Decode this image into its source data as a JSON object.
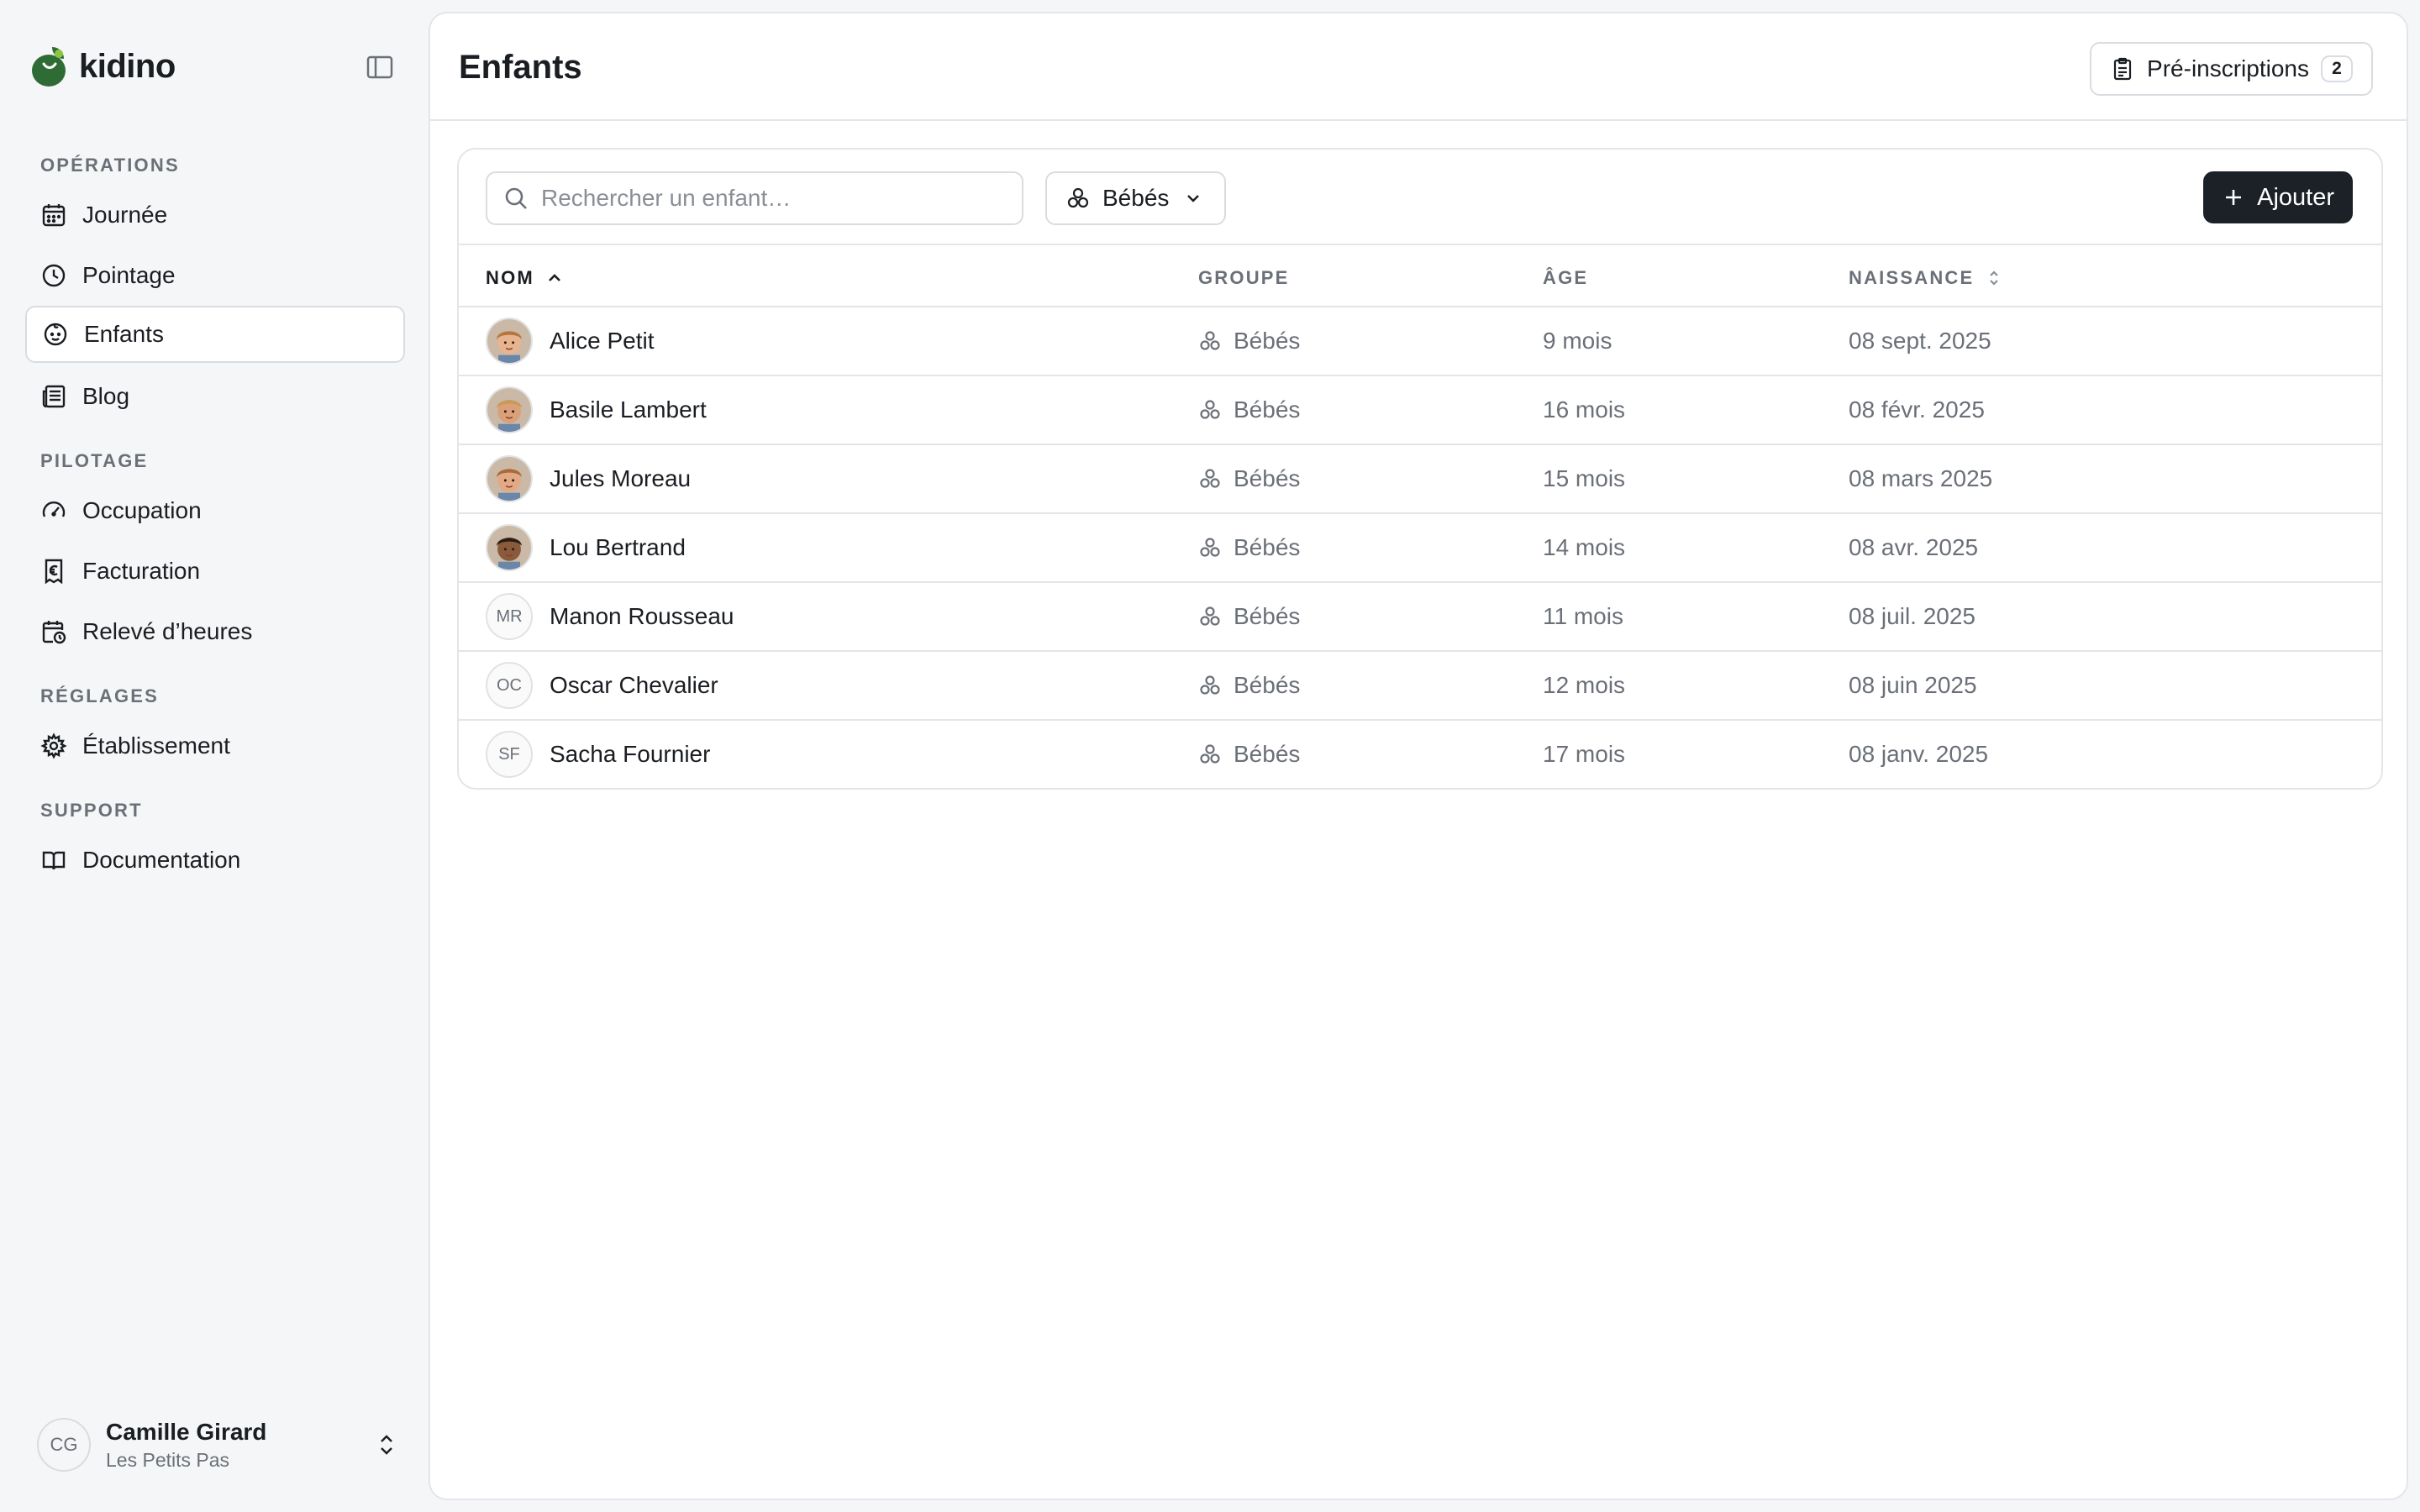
{
  "app": {
    "name": "kidino",
    "brand_color": "#2f6b35"
  },
  "sidebar": {
    "sections": [
      {
        "label": "OPÉRATIONS",
        "items": [
          {
            "label": "Journée",
            "icon": "calendar-icon"
          },
          {
            "label": "Pointage",
            "icon": "clock-icon"
          },
          {
            "label": "Enfants",
            "icon": "child-face-icon",
            "active": true
          },
          {
            "label": "Blog",
            "icon": "newspaper-icon"
          }
        ]
      },
      {
        "label": "PILOTAGE",
        "items": [
          {
            "label": "Occupation",
            "icon": "gauge-icon"
          },
          {
            "label": "Facturation",
            "icon": "invoice-euro-icon"
          },
          {
            "label": "Relevé d’heures",
            "icon": "calendar-clock-icon"
          }
        ]
      },
      {
        "label": "RÉGLAGES",
        "items": [
          {
            "label": "Établissement",
            "icon": "gear-icon"
          }
        ]
      },
      {
        "label": "SUPPORT",
        "items": [
          {
            "label": "Documentation",
            "icon": "book-icon"
          }
        ]
      }
    ],
    "user": {
      "initials": "CG",
      "name": "Camille Girard",
      "organization": "Les Petits Pas"
    }
  },
  "header": {
    "title": "Enfants",
    "preinscriptions_label": "Pré-inscriptions",
    "preinscriptions_count": "2"
  },
  "toolbar": {
    "search_placeholder": "Rechercher un enfant…",
    "group_filter_value": "Bébés",
    "add_label": "Ajouter"
  },
  "table": {
    "columns": [
      "NOM",
      "GROUPE",
      "ÂGE",
      "NAISSANCE"
    ],
    "sorted_column": "NOM",
    "rows": [
      {
        "name": "Alice Petit",
        "initials": "",
        "photo": true,
        "group": "Bébés",
        "age": "9 mois",
        "birth": "08 sept. 2025"
      },
      {
        "name": "Basile Lambert",
        "initials": "",
        "photo": true,
        "group": "Bébés",
        "age": "16 mois",
        "birth": "08 févr. 2025"
      },
      {
        "name": "Jules Moreau",
        "initials": "",
        "photo": true,
        "group": "Bébés",
        "age": "15 mois",
        "birth": "08 mars 2025"
      },
      {
        "name": "Lou Bertrand",
        "initials": "",
        "photo": true,
        "group": "Bébés",
        "age": "14 mois",
        "birth": "08 avr. 2025"
      },
      {
        "name": "Manon Rousseau",
        "initials": "MR",
        "photo": false,
        "group": "Bébés",
        "age": "11 mois",
        "birth": "08 juil. 2025"
      },
      {
        "name": "Oscar Chevalier",
        "initials": "OC",
        "photo": false,
        "group": "Bébés",
        "age": "12 mois",
        "birth": "08 juin 2025"
      },
      {
        "name": "Sacha Fournier",
        "initials": "SF",
        "photo": false,
        "group": "Bébés",
        "age": "17 mois",
        "birth": "08 janv. 2025"
      }
    ]
  }
}
